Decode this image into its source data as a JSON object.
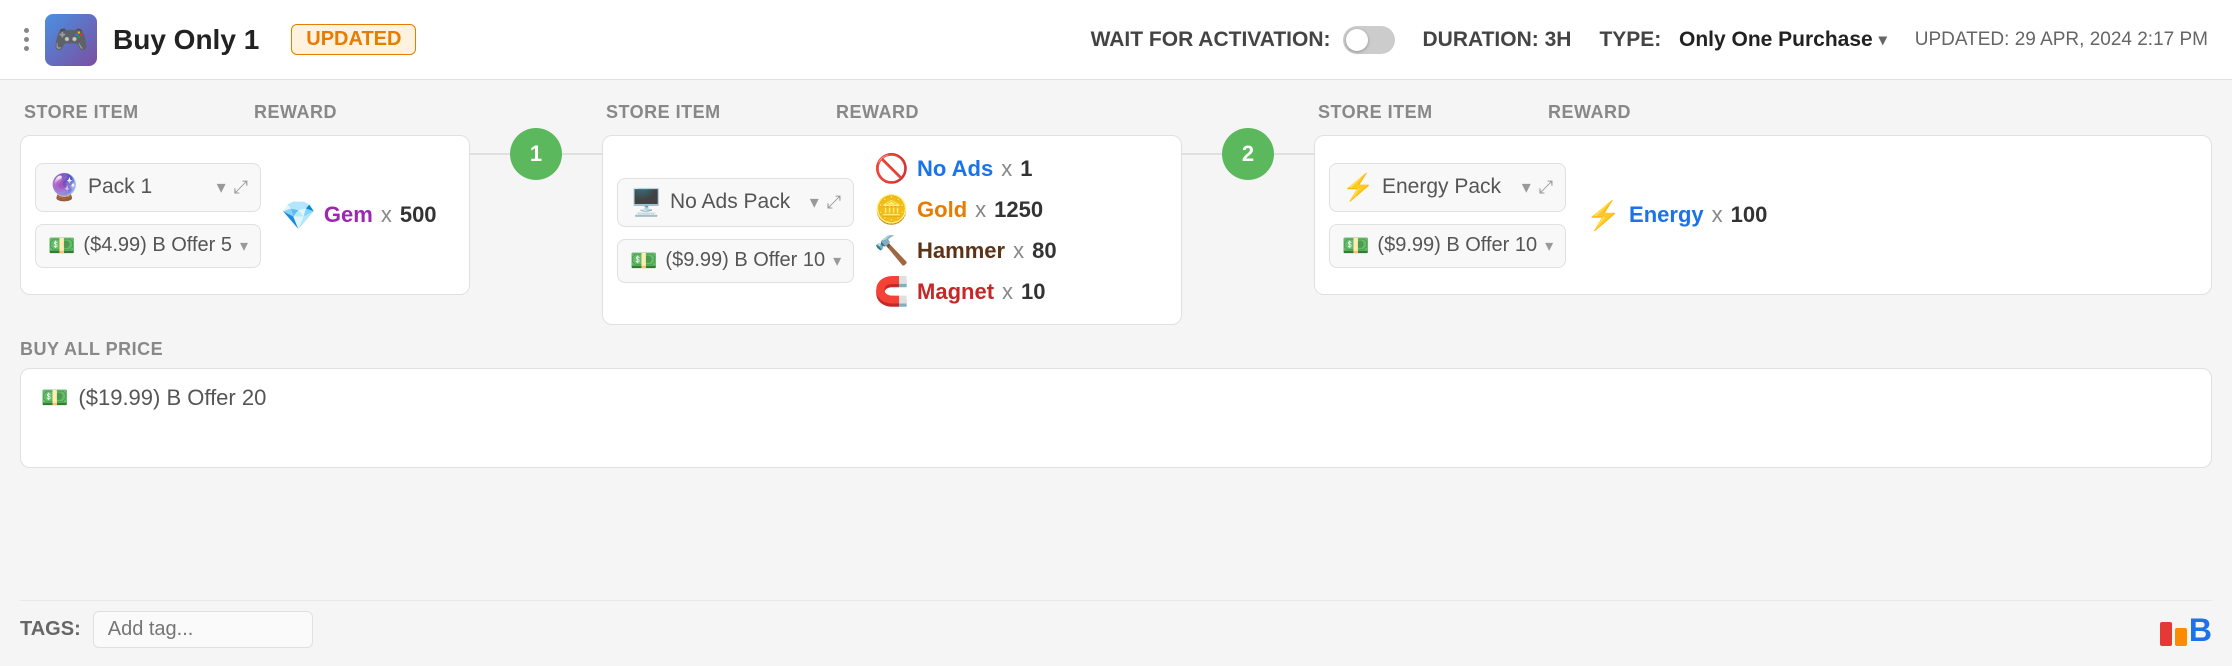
{
  "header": {
    "dots_icon": "⋮",
    "app_icon": "🎮",
    "title": "Buy Only 1",
    "badge": "UPDATED",
    "wait_activation_label": "WAIT FOR ACTIVATION:",
    "duration_label": "DURATION: 3H",
    "type_label": "TYPE:",
    "type_value": "Only One Purchase",
    "updated_label": "UPDATED: 29 APR, 2024 2:17 PM"
  },
  "sections": [
    {
      "id": "section1",
      "store_item_label": "STORE ITEM",
      "reward_label": "REWARD",
      "item_icon": "🔮",
      "item_name": "Pack 1",
      "offer_icon": "💵",
      "offer_name": "($4.99) B Offer 5",
      "rewards": [
        {
          "icon": "💎",
          "name": "Gem",
          "x": "x",
          "amount": "500",
          "color": "#9c27b0"
        }
      ]
    },
    {
      "id": "section2",
      "connector_number": "1",
      "store_item_label": "STORE ITEM",
      "reward_label": "REWARD",
      "item_icon": "🖥️",
      "item_name": "No Ads Pack",
      "offer_icon": "💵",
      "offer_name": "($9.99) B Offer 10",
      "rewards": [
        {
          "icon": "🚫",
          "name": "No Ads",
          "x": "x",
          "amount": "1",
          "color": "#1a73e8"
        },
        {
          "icon": "🪙",
          "name": "Gold",
          "x": "x",
          "amount": "1250",
          "color": "#e67c00"
        },
        {
          "icon": "🔨",
          "name": "Hammer",
          "x": "x",
          "amount": "80",
          "color": "#5c3317"
        },
        {
          "icon": "🧲",
          "name": "Magnet",
          "x": "x",
          "amount": "10",
          "color": "#c62828"
        }
      ]
    },
    {
      "id": "section3",
      "connector_number": "2",
      "store_item_label": "STORE ITEM",
      "reward_label": "REWARD",
      "item_icon": "⚡",
      "item_name": "Energy Pack",
      "offer_icon": "💵",
      "offer_name": "($9.99) B Offer 10",
      "rewards": [
        {
          "icon": "⚡",
          "name": "Energy",
          "x": "x",
          "amount": "100",
          "color": "#1a73e8"
        }
      ]
    }
  ],
  "buy_all": {
    "label": "BUY ALL PRICE",
    "icon": "💵",
    "value": "($19.99) B Offer 20"
  },
  "tags": {
    "label": "TAGS:",
    "placeholder": "Add tag..."
  }
}
